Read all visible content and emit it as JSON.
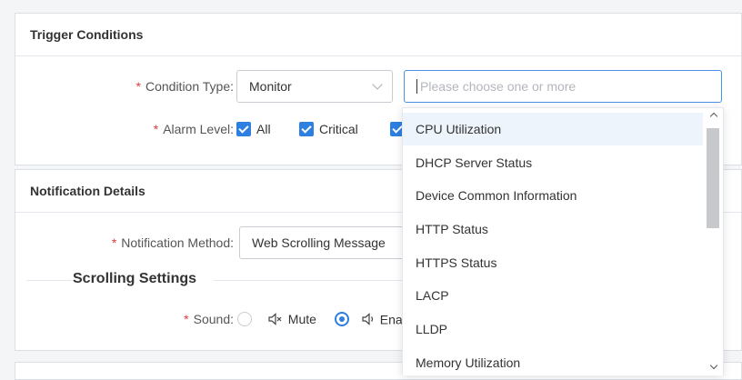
{
  "trigger": {
    "title": "Trigger Conditions",
    "condition_type_label": "Condition Type",
    "condition_type_value": "Monitor",
    "condition_search_placeholder": "Please choose one or more",
    "alarm_level_label": "Alarm Level",
    "alarm_levels": [
      {
        "label": "All",
        "checked": true
      },
      {
        "label": "Critical",
        "checked": true
      }
    ]
  },
  "notification": {
    "title": "Notification Details",
    "method_label": "Notification Method",
    "method_value": "Web Scrolling Message",
    "scrolling_settings": "Scrolling Settings",
    "sound_label": "Sound",
    "sound_mute": "Mute",
    "sound_enable_partial": "Enal"
  },
  "required_mark": "*",
  "label_colon": ":",
  "dropdown": {
    "items": [
      "CPU Utilization",
      "DHCP Server Status",
      "Device Common Information",
      "HTTP Status",
      "HTTPS Status",
      "LACP",
      "LLDP",
      "Memory Utilization"
    ],
    "highlighted_index": 0
  },
  "colors": {
    "accent": "#2d7fe0",
    "required": "#e23b3b",
    "highlight": "#eef4fc"
  }
}
